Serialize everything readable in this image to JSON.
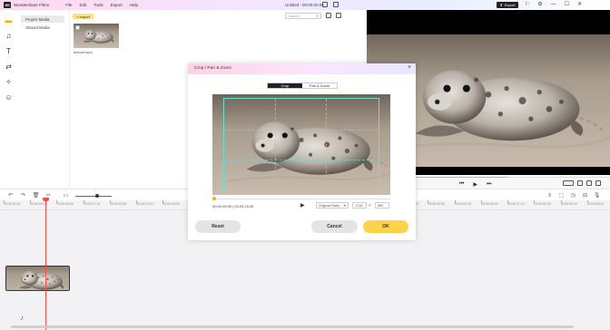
{
  "titlebar": {
    "logo": "Wf",
    "app_name": "Wondershare Filmo",
    "menu": [
      "File",
      "Edit",
      "Tools",
      "Export",
      "Help"
    ],
    "doc_title": "Untitled : 00:00:00:05",
    "export_label": "Export",
    "win_ctrls": [
      "⚐",
      "⚙",
      "—",
      "☐",
      "✕"
    ]
  },
  "media_side": {
    "items": [
      "Project Media",
      "Shared Media"
    ]
  },
  "media_main": {
    "import_label": "Import",
    "search_placeholder": "Search",
    "thumb_name": "animal.mp4"
  },
  "timeline": {
    "ticks": [
      "00:00:00:00",
      "00:00:03:20",
      "00:00:05:00",
      "00:00:07:10",
      "00:00:10:00",
      "00:00:12:10",
      "00:00:15:00",
      "00:00:17:10",
      "00:00:20:00",
      "00:00:22:10",
      "00:00:25:00",
      "00:00:27:10",
      "00:00:30:00",
      "00:00:32:10",
      "00:00:35:00",
      "00:00:37:10",
      "00:00:40:00",
      "00:00:42:10",
      "00:00:45:00",
      "00:00:47:10",
      "00:00:50:00",
      "00:00:52:10",
      "00:00:55:00"
    ],
    "zoom_level": 0.6
  },
  "preview": {
    "progress": 0.58
  },
  "dialog": {
    "title": "Crop / Pan & Zoom",
    "tabs": [
      "Crop",
      "Pan & Zoom"
    ],
    "timecode": "00:00:00:00 | 00:00:15:05",
    "ratio_label": "Original Ratio",
    "width": "1716",
    "height": "960",
    "reset_label": "Reset",
    "cancel_label": "Cancel",
    "ok_label": "OK"
  },
  "colors": {
    "accent": "#ffd24a",
    "playhead": "#ff4a4a",
    "crop_frame": "#69e0d0"
  }
}
